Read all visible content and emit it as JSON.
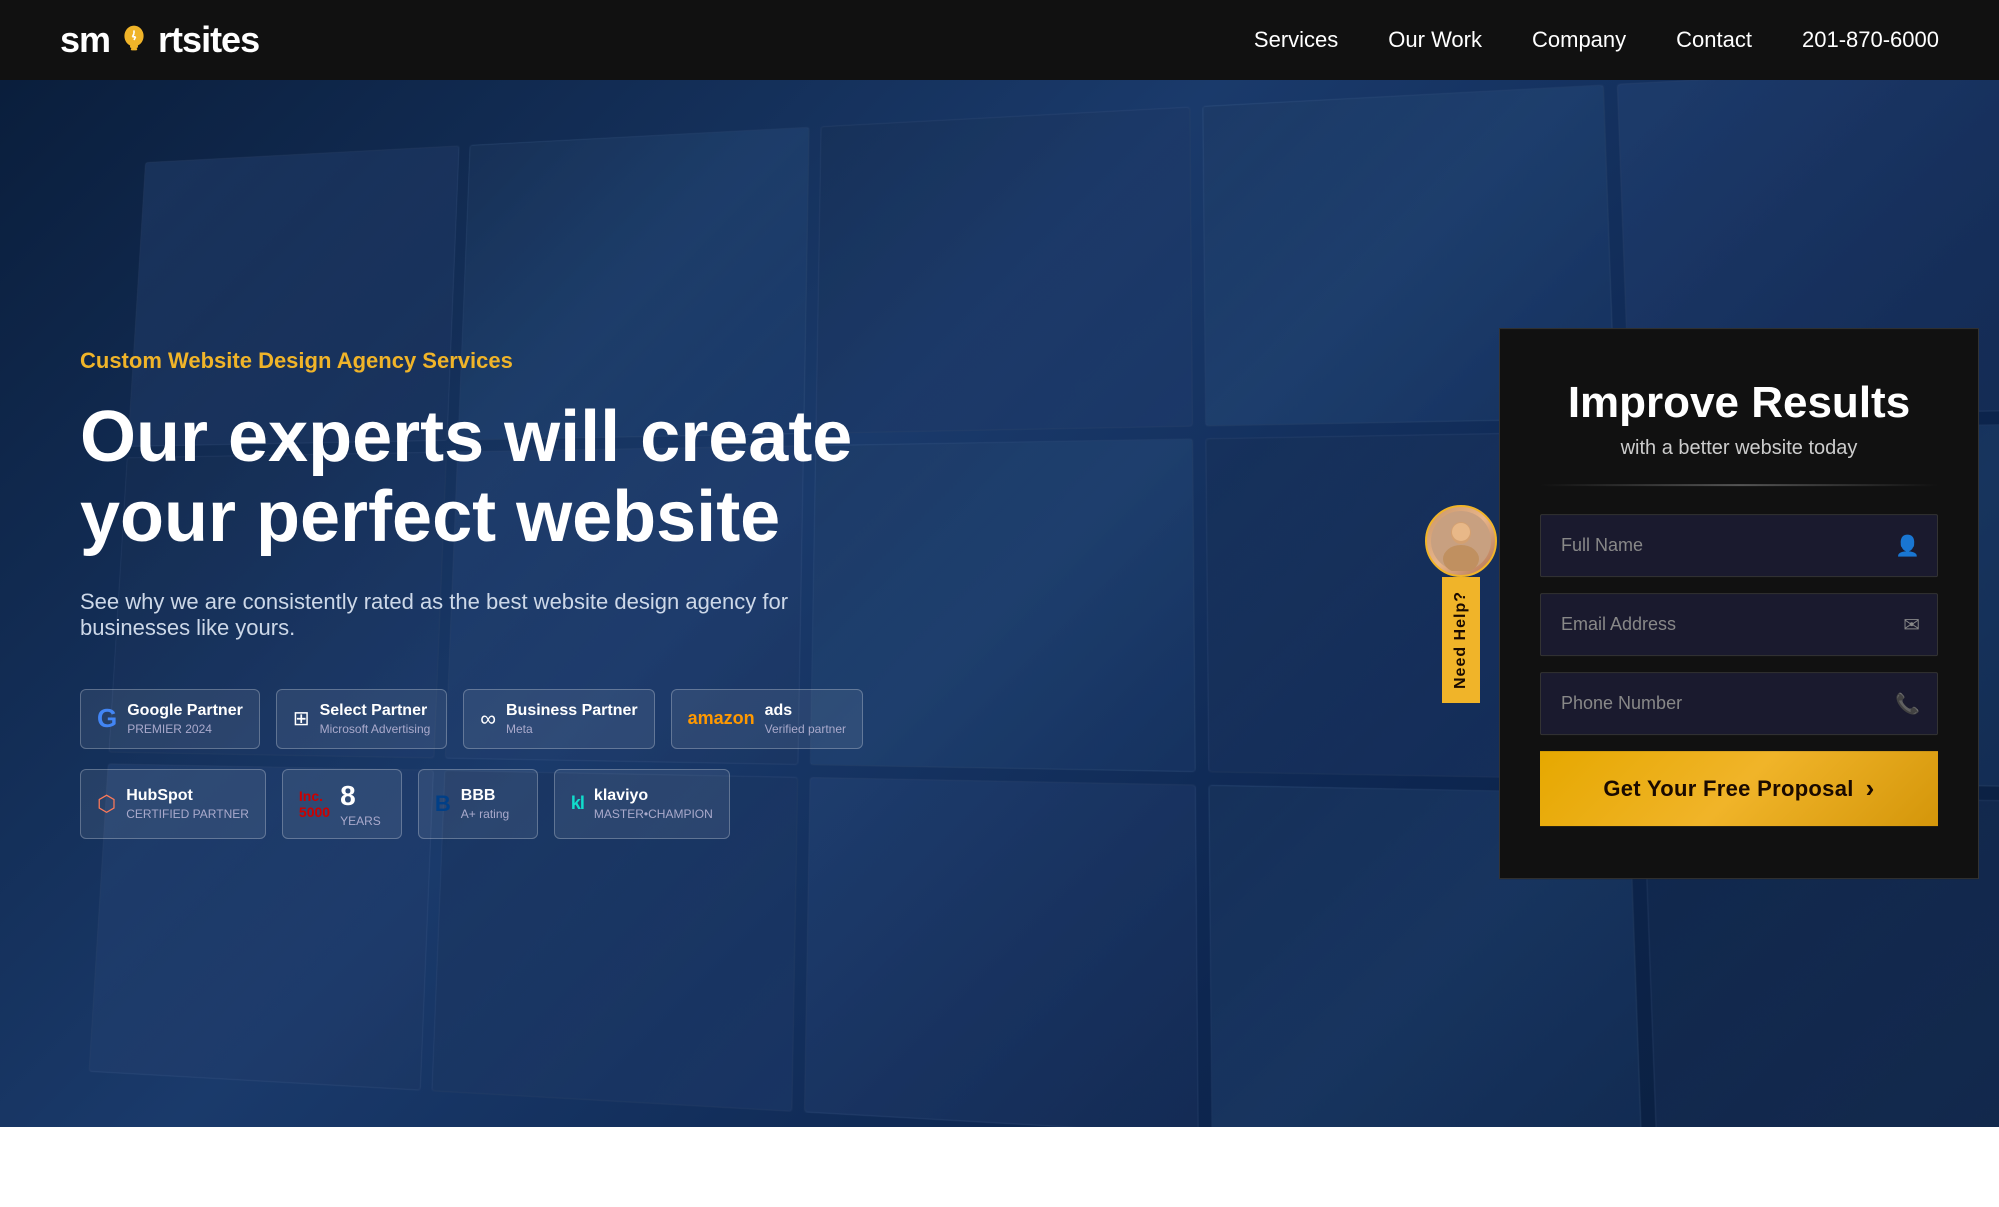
{
  "nav": {
    "logo": "smartsites",
    "links": [
      {
        "id": "services",
        "label": "Services"
      },
      {
        "id": "our-work",
        "label": "Our Work"
      },
      {
        "id": "company",
        "label": "Company"
      },
      {
        "id": "contact",
        "label": "Contact"
      }
    ],
    "phone": "201-870-6000"
  },
  "hero": {
    "subtitle": "Custom Website Design Agency Services",
    "title": "Our experts will create your perfect website",
    "description": "See why we are consistently rated as the best website design agency for businesses like yours.",
    "badges": [
      {
        "id": "google",
        "icon": "G",
        "main": "Google Partner",
        "sub": "PREMIER 2024"
      },
      {
        "id": "microsoft",
        "icon": "M",
        "main": "Select Partner",
        "sub": "Microsoft Advertising"
      },
      {
        "id": "meta",
        "icon": "◎",
        "main": "Business Partner",
        "sub": "Meta"
      },
      {
        "id": "amazon",
        "icon": "a",
        "main": "amazon ads",
        "sub": "Verified partner"
      },
      {
        "id": "hubspot",
        "icon": "⬡",
        "main": "HubSpot",
        "sub": "CERTIFIED PARTNER"
      },
      {
        "id": "inc5000",
        "icon": "#",
        "main": "Inc 5000",
        "sub": "8 YEARS"
      },
      {
        "id": "bbb",
        "icon": "B",
        "main": "BBB",
        "sub": "A+ rating"
      },
      {
        "id": "klaviyo",
        "icon": "k",
        "main": "klaviyo",
        "sub": "MASTER•CHAMPION"
      }
    ]
  },
  "form": {
    "title_line1": "Improve Results",
    "subtitle": "with a better website today",
    "full_name_placeholder": "Full Name",
    "email_placeholder": "Email Address",
    "phone_placeholder": "Phone Number",
    "submit_label": "Get Your Free Proposal"
  },
  "need_help": {
    "label": "Need Help?"
  }
}
